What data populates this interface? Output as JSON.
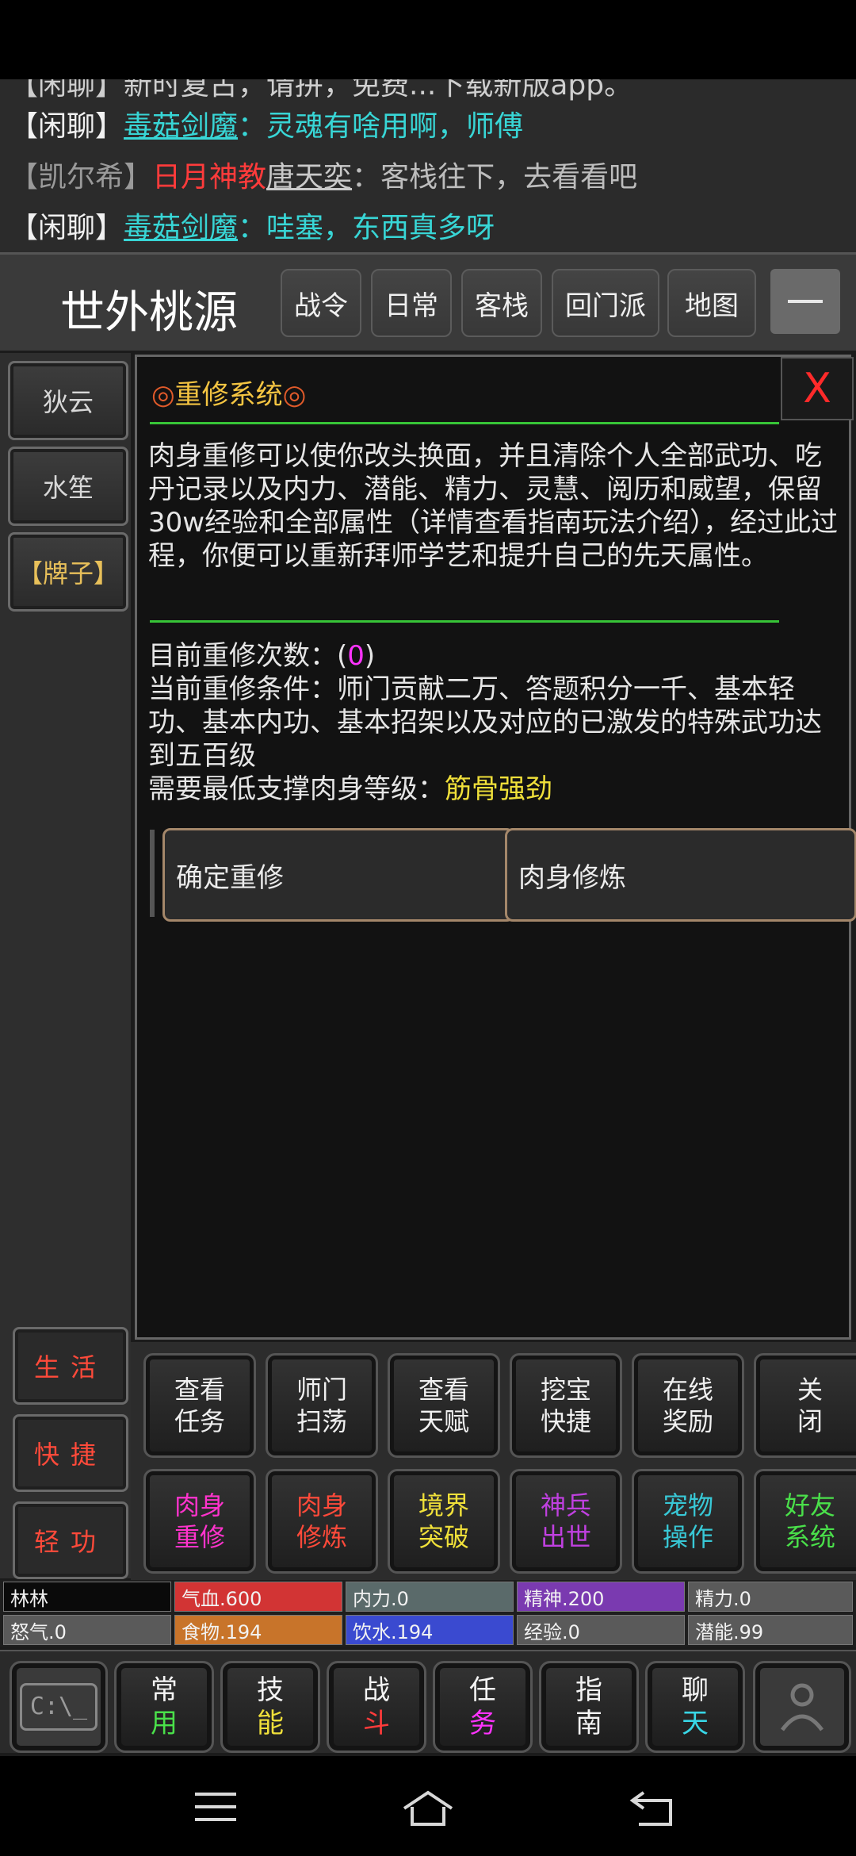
{
  "chat": {
    "cut_line": "【闲聊】新时复古，请拼，免费...下载新版app。",
    "lines": [
      {
        "tag": "【闲聊】",
        "name": "毒菇剑魔",
        "sep": "：",
        "msg": "灵魂有啥用啊，师傅"
      },
      {
        "tag": "【凯尔希】",
        "sect": "日月神教",
        "name": "唐天奕",
        "sep": "：",
        "msg": "客栈往下，去看看吧"
      },
      {
        "tag": "【闲聊】",
        "name": "毒菇剑魔",
        "sep": "：",
        "msg": "哇塞，东西真多呀"
      }
    ]
  },
  "header": {
    "location": "世外桃源",
    "nav": [
      "战令",
      "日常",
      "客栈",
      "回门派",
      "地图"
    ]
  },
  "npcs": [
    "狄云",
    "水笙",
    "【牌子】"
  ],
  "side_buttons": [
    "生活",
    "快捷",
    "轻功"
  ],
  "panel": {
    "title": "重修系统",
    "title_ornament": "◎",
    "close": "X",
    "description": "肉身重修可以使你改头换面，并且清除个人全部武功、吃丹记录以及内力、潜能、精力、灵慧、阅历和威望，保留30w经验和全部属性（详情查看指南玩法介绍），经过此过程，你便可以重新拜师学艺和提升自己的先天属性。",
    "count_label": "目前重修次数：",
    "count_open": "(",
    "count_value": "0",
    "count_close": ")",
    "condition": "当前重修条件：师门贡献二万、答题积分一千、基本轻功、基本内功、基本招架以及对应的已激发的特殊武功达到五百级",
    "level_label": "需要最低支撑肉身等级：",
    "level_value": "筋骨强劲",
    "buttons": [
      "确定重修",
      "肉身修炼"
    ]
  },
  "grid": {
    "row1": [
      {
        "l1": "查看",
        "l2": "任务"
      },
      {
        "l1": "师门",
        "l2": "扫荡"
      },
      {
        "l1": "查看",
        "l2": "天赋"
      },
      {
        "l1": "挖宝",
        "l2": "快捷"
      },
      {
        "l1": "在线",
        "l2": "奖励"
      },
      {
        "l1": "关",
        "l2": "闭"
      }
    ],
    "row2": [
      {
        "l1": "肉身",
        "l2": "重修",
        "color": "#ff33cc"
      },
      {
        "l1": "肉身",
        "l2": "修炼",
        "color": "#ff4a3a"
      },
      {
        "l1": "境界",
        "l2": "突破",
        "color": "#f0e03a"
      },
      {
        "l1": "神兵",
        "l2": "出世",
        "color": "#c040e0"
      },
      {
        "l1": "宠物",
        "l2": "操作",
        "color": "#38c8d6"
      },
      {
        "l1": "好友",
        "l2": "系统",
        "color": "#4ae04a"
      }
    ]
  },
  "stats": {
    "row1": [
      {
        "text": "林林",
        "color": "#0a0a0a"
      },
      {
        "text": "气血.600",
        "color": "#d23434"
      },
      {
        "text": "内力.0",
        "color": "#5a6a6a"
      },
      {
        "text": "精神.200",
        "color": "#7a3ab0"
      },
      {
        "text": "精力.0",
        "color": "#5a5a5a"
      }
    ],
    "row2": [
      {
        "text": "怒气.0",
        "color": "#5a5a5a"
      },
      {
        "text": "食物.194",
        "color": "#c8742a"
      },
      {
        "text": "饮水.194",
        "color": "#3a4ad0"
      },
      {
        "text": "经验.0",
        "color": "#5a5a5a"
      },
      {
        "text": "潜能.99",
        "color": "#5a5a5a"
      }
    ]
  },
  "bottom": [
    {
      "l1": "常",
      "l2": "用",
      "color": "#4ae04a"
    },
    {
      "l1": "技",
      "l2": "能",
      "color": "#f0e03a"
    },
    {
      "l1": "战",
      "l2": "斗",
      "color": "#ff3b3b"
    },
    {
      "l1": "任",
      "l2": "务",
      "color": "#ff33ff"
    },
    {
      "l1": "指",
      "l2": "南",
      "color": "#f5f5f5"
    },
    {
      "l1": "聊",
      "l2": "天",
      "color": "#38d6e6"
    }
  ],
  "terminal_icon_text": "C:\\_",
  "system_nav": [
    "menu-icon",
    "home-icon",
    "back-icon"
  ]
}
